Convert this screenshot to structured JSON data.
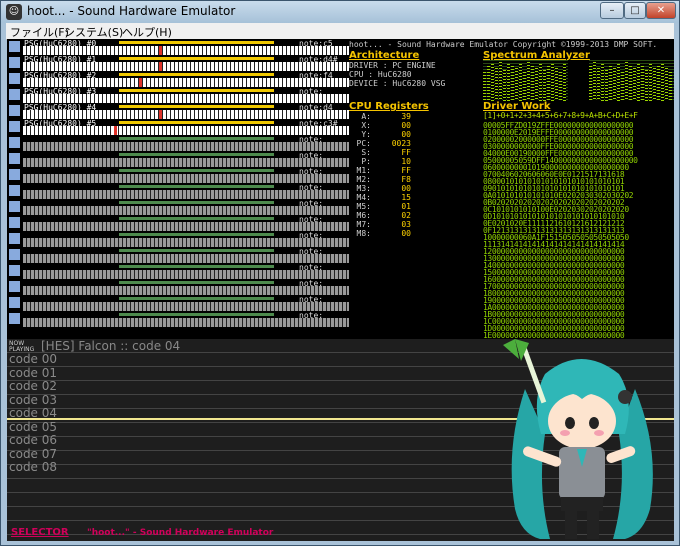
{
  "window": {
    "title": "hoot... - Sound Hardware Emulator",
    "app_icon": "hoot-face-icon"
  },
  "menu": [
    {
      "label": "ファイル(F)"
    },
    {
      "label": "システム(S)"
    },
    {
      "label": "ヘルプ(H)"
    }
  ],
  "channels": [
    {
      "name": "PSG(HuC6280) #0",
      "note": "note:c5"
    },
    {
      "name": "PSG(HuC6280) #1",
      "note": "note:d4#"
    },
    {
      "name": "PSG(HuC6280) #2",
      "note": "note:f4"
    },
    {
      "name": "PSG(HuC6280) #3",
      "note": "note:"
    },
    {
      "name": "PSG(HuC6280) #4",
      "note": "note:d4"
    },
    {
      "name": "PSG(HuC6280) #5",
      "note": "note:c3#"
    },
    {
      "name": "",
      "note": "note:"
    },
    {
      "name": "",
      "note": "note:"
    },
    {
      "name": "",
      "note": "note:"
    },
    {
      "name": "",
      "note": "note:"
    },
    {
      "name": "",
      "note": "note:"
    },
    {
      "name": "",
      "note": "note:"
    },
    {
      "name": "",
      "note": "note:"
    },
    {
      "name": "",
      "note": "note:"
    },
    {
      "name": "",
      "note": "note:"
    },
    {
      "name": "",
      "note": "note:"
    },
    {
      "name": "",
      "note": "note:"
    },
    {
      "name": "",
      "note": "note:"
    }
  ],
  "copyright": "hoot... - Sound Hardware Emulator Copyright ©1999-2013 DMP SOFT.",
  "architecture": {
    "title": "Architecture",
    "lines": [
      "DRIVER : PC ENGINE",
      "CPU    : HuC6280",
      "DEVICE : HuC6280 VSG"
    ]
  },
  "cpu_registers": {
    "title": "CPU Registers",
    "regs": [
      {
        "name": "A:",
        "value": "39"
      },
      {
        "name": "X:",
        "value": "00"
      },
      {
        "name": "Y:",
        "value": "00"
      },
      {
        "name": "PC:",
        "value": "0023"
      },
      {
        "name": "S:",
        "value": "FF"
      },
      {
        "name": "P:",
        "value": "10"
      },
      {
        "name": "M1:",
        "value": "FF"
      },
      {
        "name": "M2:",
        "value": "F8"
      },
      {
        "name": "M3:",
        "value": "00"
      },
      {
        "name": "M4:",
        "value": "15"
      },
      {
        "name": "M5:",
        "value": "01"
      },
      {
        "name": "M6:",
        "value": "02"
      },
      {
        "name": "M7:",
        "value": "03"
      },
      {
        "name": "M8:",
        "value": "00"
      }
    ]
  },
  "spectrum": {
    "title": "Spectrum Analyzer",
    "levels": [
      0.7,
      0.85,
      0.9,
      0.8,
      0.95,
      0.75,
      0.9,
      0.85,
      0.8,
      0.9,
      0.7,
      0.95,
      0.85,
      0.8,
      0.9,
      0.75,
      0.85,
      0.9,
      0.8,
      0.7,
      0.9,
      0.85,
      0.95,
      0.8,
      0.9,
      0.75,
      0.85,
      0.8,
      0.9,
      0.7,
      0.95,
      0.85,
      0.8,
      0.9,
      0.85,
      0.75,
      0.9,
      0.8,
      0.85,
      0.9,
      0.8,
      0.7
    ]
  },
  "driver_work": {
    "title": "Driver Work",
    "header": "[1]+0+1+2+3+4+5+6+7+8+9+A+B+C+D+E+F",
    "rows": [
      "00005FFZD019ZFFE000000000000000000",
      "0100000E2019EFFE000000000000000000",
      "02000002000000FFE00000000000000000",
      "0300000000000FFE000000000000000000",
      "04000E00190000FFE00000000000000000",
      "05000005059DFF140000000000000000000",
      "060000000010190000000000000000000",
      "0700406020606060E0E0121517131618",
      "08000101010101010101010101010101",
      "09010101010101010101010101010101",
      "0A010101010101010E0202030302030202",
      "0B020202020202020202020202020202",
      "0C1010101010100E02020302020202020",
      "0D101010101010101010101010101010",
      "0E0201020E1111121610121612121212",
      "0F121313131313131313131313131313",
      "10000000060A1F1515050505050505050",
      "11131414141414141414141414141414",
      "12000000000000000000000000000000",
      "13000000000000000000000000000000",
      "14000000000000000000000000000000",
      "15000000000000000000000000000000",
      "16000000000000000000000000000000",
      "17000000000000000000000000000000",
      "18000000000000000000000000000000",
      "19000000000000000000000000000000",
      "1A000000000000000000000000000000",
      "1B000000000000000000000000000000",
      "1C000000000000000000000000000000",
      "1D000000000000000000000000000000",
      "1E000000000000000000000000000000",
      "1F000000000000000000000000000000"
    ]
  },
  "now_playing": {
    "label_top": "NOW",
    "label_bottom": "PLAYING",
    "title": "[HES] Falcon :: code 04"
  },
  "codes": [
    "code 00",
    "code 01",
    "code 02",
    "code 03",
    "code 04",
    "code 05",
    "code 06",
    "code 07",
    "code 08"
  ],
  "selector": {
    "label": "SELECTOR",
    "text": "\"hoot...\" - Sound Hardware Emulator"
  }
}
